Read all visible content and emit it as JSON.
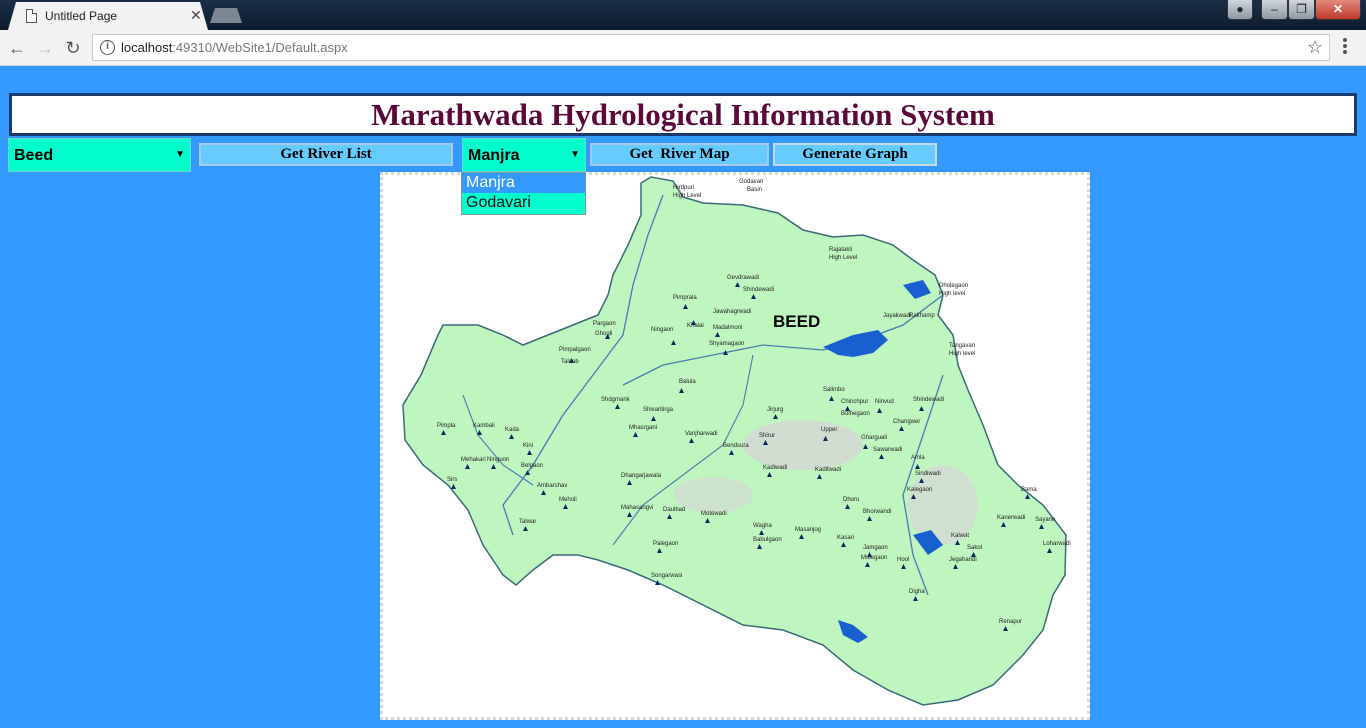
{
  "browser": {
    "tab_title": "Untitled Page",
    "url_host": "localhost",
    "url_rest": ":49310/WebSite1/Default.aspx"
  },
  "page": {
    "title": "Marathwada Hydrological Information System",
    "district_select": {
      "selected": "Beed"
    },
    "river_select": {
      "selected": "Manjra",
      "options": [
        "Manjra",
        "Godavari"
      ]
    },
    "buttons": {
      "get_river_list": "Get River List",
      "get_river_map": "Get  River Map",
      "generate_graph": "Generate Graph"
    }
  },
  "map": {
    "district_label": "BEED",
    "labels": [
      {
        "key": "Godavari",
        "text": "Godavari"
      },
      {
        "key": "Basin",
        "text": "Basin"
      },
      {
        "key": "Hirdpuri",
        "text": "Hirdpuri"
      },
      {
        "key": "HighLevel1",
        "text": "High Level"
      },
      {
        "key": "Rajatakli",
        "text": "Rajatakli"
      },
      {
        "key": "HighLevel2",
        "text": "High Level"
      },
      {
        "key": "Dholegaon",
        "text": "Dholegaon"
      },
      {
        "key": "HighLevel3",
        "text": "High level"
      },
      {
        "key": "Tangavan",
        "text": "Tangavan"
      },
      {
        "key": "HighLevel4",
        "text": "High level"
      },
      {
        "key": "Gevdrawadi",
        "text": "Gevdrawadi"
      },
      {
        "key": "Shindewadi",
        "text": "Shindewadi"
      },
      {
        "key": "Pimprala",
        "text": "Pimprala"
      },
      {
        "key": "Jawahagrwadi",
        "text": "Jawahagrwadi"
      },
      {
        "key": "Ningaon",
        "text": "Ningaon"
      },
      {
        "key": "Khalal",
        "text": "Khalal"
      },
      {
        "key": "Madalmoni",
        "text": "Madalmoni"
      },
      {
        "key": "Shyamagaon",
        "text": "Shyamagaon"
      },
      {
        "key": "Pargaon",
        "text": "Pargaon"
      },
      {
        "key": "Ghogli",
        "text": "Ghogli"
      },
      {
        "key": "Pimpalgaon",
        "text": "Pimpalgaon"
      },
      {
        "key": "Talaab",
        "text": "Talaab"
      },
      {
        "key": "Jayakwadi",
        "text": "Jayakwadi"
      },
      {
        "key": "Rakhamp",
        "text": "Rakhamp"
      },
      {
        "key": "Balula",
        "text": "Balula"
      },
      {
        "key": "Shdgmank",
        "text": "Shdgmank"
      },
      {
        "key": "Shivaritirga",
        "text": "Shivaritirga"
      },
      {
        "key": "Mhasrgani",
        "text": "Mhasrgani"
      },
      {
        "key": "Salimbo",
        "text": "Salimbo"
      },
      {
        "key": "Ninvud",
        "text": "Ninvud"
      },
      {
        "key": "Shindewadi2",
        "text": "Shindewadi"
      },
      {
        "key": "Jirjurg",
        "text": "Jirjurg"
      },
      {
        "key": "Chinchpur",
        "text": "Chinchpur"
      },
      {
        "key": "Bolhegaon",
        "text": "Bolhegaon"
      },
      {
        "key": "Changwer",
        "text": "Changwer"
      },
      {
        "key": "Shirur",
        "text": "Shirur"
      },
      {
        "key": "Upper",
        "text": "Upper"
      },
      {
        "key": "Bendsura",
        "text": "Bendsura"
      },
      {
        "key": "Sawarwadi",
        "text": "Sawarwadi"
      },
      {
        "key": "Gharguali",
        "text": "Gharguali"
      },
      {
        "key": "Vanjharwadi",
        "text": "Vanjharwadi"
      },
      {
        "key": "Kadiwadi",
        "text": "Kadiwadi"
      },
      {
        "key": "Kaditwadi",
        "text": "Kaditwadi"
      },
      {
        "key": "Amla",
        "text": "Amla"
      },
      {
        "key": "Dhangarjawala",
        "text": "Dhangarjawala"
      },
      {
        "key": "Mahasangvi",
        "text": "Mahasangvi"
      },
      {
        "key": "Daulbad",
        "text": "Daulbad"
      },
      {
        "key": "Motewadi",
        "text": "Motewadi"
      },
      {
        "key": "Dhoru",
        "text": "Dhoru"
      },
      {
        "key": "Wagha",
        "text": "Wagha"
      },
      {
        "key": "Babulgaon",
        "text": "Babulgaon"
      },
      {
        "key": "Masanjog",
        "text": "Masanjog"
      },
      {
        "key": "Kasari",
        "text": "Kasari"
      },
      {
        "key": "Bhorwandi",
        "text": "Bhorwandi"
      },
      {
        "key": "Sindiwadi",
        "text": "Sindiwadi"
      },
      {
        "key": "Kalegaon",
        "text": "Kalegaon"
      },
      {
        "key": "Palegaon",
        "text": "Palegaon"
      },
      {
        "key": "Jamgaon",
        "text": "Jamgaon"
      },
      {
        "key": "Mulegaon",
        "text": "Mulegaon"
      },
      {
        "key": "Hool",
        "text": "Hool"
      },
      {
        "key": "Digha",
        "text": "Digha"
      },
      {
        "key": "Jegahandi",
        "text": "Jegahandi"
      },
      {
        "key": "Sakol",
        "text": "Sakol"
      },
      {
        "key": "Kalwat",
        "text": "Kalwat"
      },
      {
        "key": "Bama",
        "text": "Bama"
      },
      {
        "key": "Kanerwadi",
        "text": "Kanerwadi"
      },
      {
        "key": "Sayane",
        "text": "Sayane"
      },
      {
        "key": "Loharwadi",
        "text": "Loharwadi"
      },
      {
        "key": "Renapur",
        "text": "Renapur"
      },
      {
        "key": "Songarwasi",
        "text": "Songarwasi"
      },
      {
        "key": "Pimpla",
        "text": "Pimpla"
      },
      {
        "key": "Kambali",
        "text": "Kambali"
      },
      {
        "key": "Mehakari",
        "text": "Mehakari"
      },
      {
        "key": "Kada",
        "text": "Kada"
      },
      {
        "key": "Kini",
        "text": "Kini"
      },
      {
        "key": "Ninguon",
        "text": "Ninguon"
      },
      {
        "key": "Belgaon",
        "text": "Belgaon"
      },
      {
        "key": "Talwar",
        "text": "Talwar"
      },
      {
        "key": "Sirs",
        "text": "Sirs"
      },
      {
        "key": "Ambarshav",
        "text": "Ambarshav"
      },
      {
        "key": "Meholi",
        "text": "Meholi"
      }
    ]
  }
}
